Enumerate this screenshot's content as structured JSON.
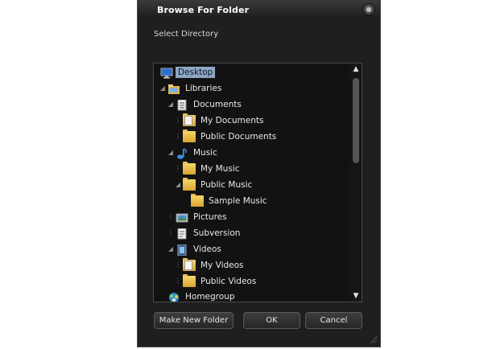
{
  "window": {
    "title": "Browse For Folder",
    "prompt": "Select Directory"
  },
  "tree": {
    "items": [
      {
        "label": "Desktop",
        "icon": "desktop-icon",
        "level": 0,
        "selected": true
      },
      {
        "label": "Libraries",
        "icon": "library-folder-icon",
        "level": 1
      },
      {
        "label": "Documents",
        "icon": "documents-library-icon",
        "level": 2
      },
      {
        "label": "My Documents",
        "icon": "folder-icon",
        "level": 3
      },
      {
        "label": "Public Documents",
        "icon": "folder-icon",
        "level": 3
      },
      {
        "label": "Music",
        "icon": "music-note-icon",
        "level": 2
      },
      {
        "label": "My Music",
        "icon": "folder-icon",
        "level": 3
      },
      {
        "label": "Public Music",
        "icon": "folder-icon",
        "level": 3
      },
      {
        "label": "Sample Music",
        "icon": "folder-icon",
        "level": 4
      },
      {
        "label": "Pictures",
        "icon": "pictures-library-icon",
        "level": 2
      },
      {
        "label": "Subversion",
        "icon": "document-library-icon",
        "level": 2
      },
      {
        "label": "Videos",
        "icon": "videos-library-icon",
        "level": 2
      },
      {
        "label": "My Videos",
        "icon": "folder-icon",
        "level": 3
      },
      {
        "label": "Public Videos",
        "icon": "folder-icon",
        "level": 3
      },
      {
        "label": "Homegroup",
        "icon": "homegroup-icon",
        "level": 1
      }
    ]
  },
  "buttons": {
    "make_new_folder": "Make New Folder",
    "ok": "OK",
    "cancel": "Cancel"
  },
  "colors": {
    "dialog_bg": "#1f1f1f",
    "selection": "#8fa6c4"
  }
}
